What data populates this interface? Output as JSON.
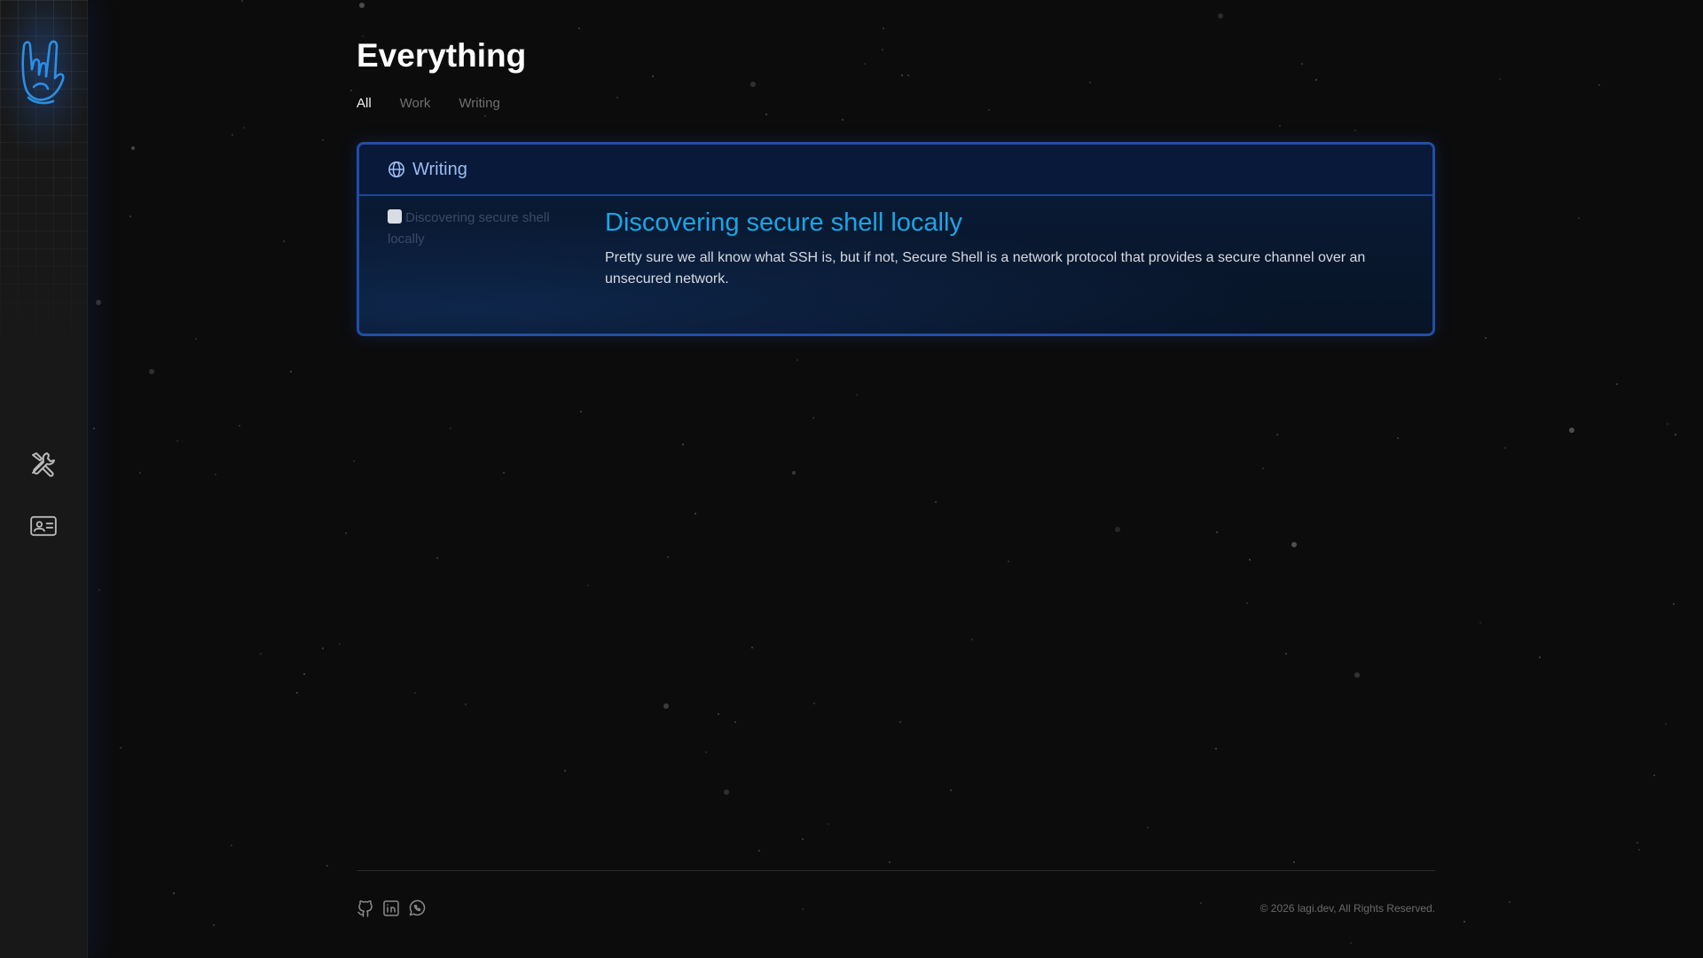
{
  "page": {
    "title": "Everything"
  },
  "tabs": [
    {
      "label": "All",
      "active": true
    },
    {
      "label": "Work",
      "active": false
    },
    {
      "label": "Writing",
      "active": false
    }
  ],
  "card": {
    "category_label": "Writing",
    "category_icon": "globe-icon",
    "image_alt": "Discovering secure shell locally",
    "post_title": "Discovering secure shell locally",
    "post_excerpt": "Pretty sure we all know what SSH is, but if not, Secure Shell is a network protocol that provides a secure channel over an unsecured network."
  },
  "sidebar": {
    "logo_icon": "rock-hand-icon",
    "items": [
      {
        "icon": "tools-icon"
      },
      {
        "icon": "contact-card-icon"
      }
    ]
  },
  "footer": {
    "social_icons": [
      "github-icon",
      "linkedin-icon",
      "whatsapp-icon"
    ],
    "copyright": "© 2026 lagi.dev, All Rights Reserved."
  },
  "colors": {
    "accent_blue": "#1aa6e6",
    "card_border": "#1f4fa8",
    "background": "#0c0c0d"
  }
}
